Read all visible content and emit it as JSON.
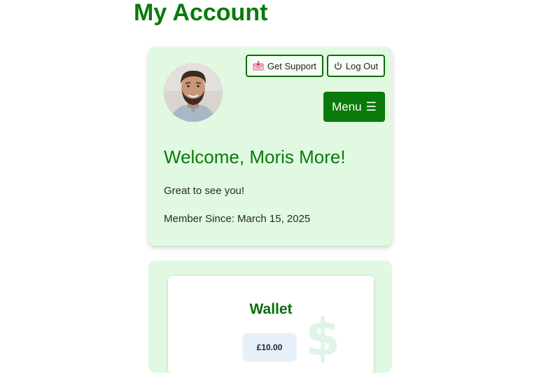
{
  "page": {
    "title": "My Account"
  },
  "account": {
    "support_label": "Get Support",
    "logout_label": "Log Out",
    "menu_label": "Menu",
    "welcome": "Welcome, Moris More!",
    "greeting": "Great to see you!",
    "member_since": "Member Since: March 15, 2025"
  },
  "wallet": {
    "title": "Wallet",
    "balance": "£10.00"
  },
  "icons": {
    "support": "envelope-download-icon",
    "logout": "power-icon",
    "menu": "hamburger-icon",
    "wallet_watermark": "dollar-icon"
  },
  "colors": {
    "accent": "#0a7a0a",
    "card_background": "#e1f8e1",
    "balance_background": "#e6f1fb"
  }
}
